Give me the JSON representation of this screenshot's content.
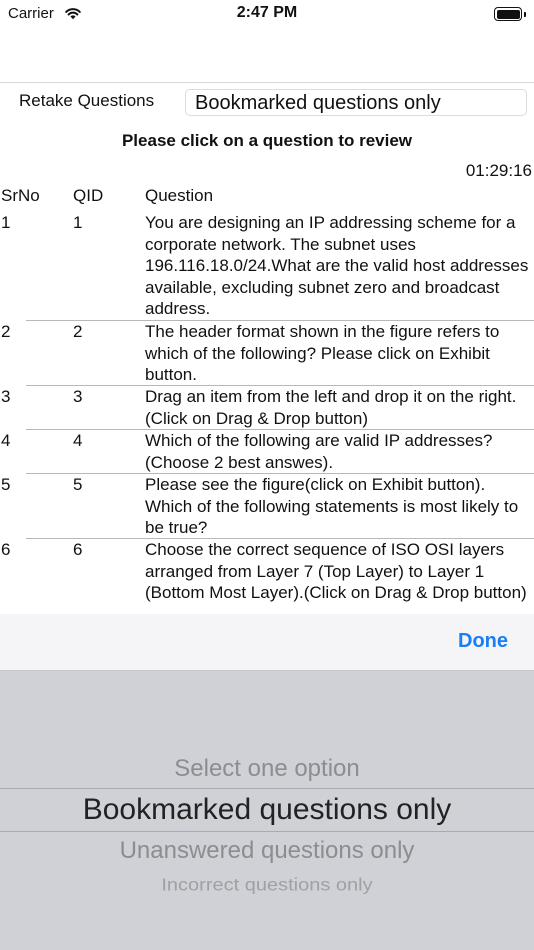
{
  "status_bar": {
    "carrier": "Carrier",
    "time": "2:47 PM"
  },
  "retake": {
    "label": "Retake Questions",
    "value": "Bookmarked questions only"
  },
  "instruction": "Please click on a question to review",
  "timer": "01:29:16",
  "table": {
    "headers": {
      "srno": "SrNo",
      "qid": "QID",
      "question": "Question"
    },
    "rows": [
      {
        "srno": "1",
        "qid": "1",
        "question": "You are designing an IP addressing scheme for a corporate network. The subnet uses 196.116.18.0/24.What are the valid host addresses available, excluding subnet zero and broadcast address."
      },
      {
        "srno": "2",
        "qid": "2",
        "question": "The header format shown in the figure refers to which of the following? Please click on Exhibit button."
      },
      {
        "srno": "3",
        "qid": "3",
        "question": "Drag an item from the left and drop it on the right.(Click on Drag & Drop button)"
      },
      {
        "srno": "4",
        "qid": "4",
        "question": "Which of the following are valid IP addresses? (Choose 2 best answes)."
      },
      {
        "srno": "5",
        "qid": "5",
        "question": "Please see the figure(click on Exhibit button). Which of the following statements is most likely to be true?"
      },
      {
        "srno": "6",
        "qid": "6",
        "question": "Choose the correct sequence of ISO OSI layers arranged from Layer 7 (Top Layer) to Layer 1 (Bottom Most Layer).(Click on Drag & Drop button)"
      }
    ]
  },
  "picker": {
    "done_label": "Done",
    "options": [
      "Select one option",
      "Bookmarked questions only",
      "Unanswered questions only",
      "Incorrect questions only"
    ],
    "selected": "Bookmarked questions only"
  },
  "colors": {
    "accent": "#1a7ef5",
    "picker_background": "#cfd1d6",
    "toolbar_background": "#f5f5f7"
  }
}
